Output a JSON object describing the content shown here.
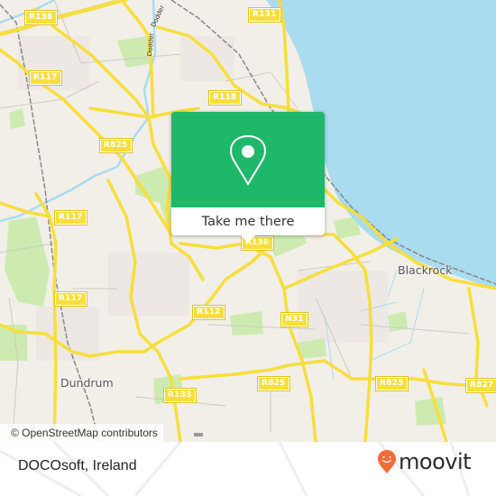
{
  "map": {
    "colors": {
      "land": "#f2efe9",
      "water": "#a9dcee",
      "park": "#cdebb0",
      "road_major": "#f7de3c",
      "railway": "#777777",
      "accent": "#1fb76a"
    },
    "road_shields": [
      {
        "id": "r138-nw",
        "label": "R138"
      },
      {
        "id": "r131",
        "label": "R131"
      },
      {
        "id": "r117-n",
        "label": "R117"
      },
      {
        "id": "r118",
        "label": "R118"
      },
      {
        "id": "r825-w",
        "label": "R825"
      },
      {
        "id": "r117-mid",
        "label": "R117"
      },
      {
        "id": "r138-center",
        "label": "R138"
      },
      {
        "id": "r117-s",
        "label": "R117"
      },
      {
        "id": "r112",
        "label": "R112"
      },
      {
        "id": "n31",
        "label": "N31"
      },
      {
        "id": "r133",
        "label": "R133"
      },
      {
        "id": "r825-s",
        "label": "R825"
      },
      {
        "id": "r825-e",
        "label": "R825"
      },
      {
        "id": "r827",
        "label": "R827"
      }
    ],
    "places": [
      {
        "id": "blackrock",
        "label": "Blackrock"
      },
      {
        "id": "dundrum",
        "label": "Dundrum"
      }
    ],
    "river_labels": [
      {
        "id": "dodder-1",
        "label": "Dodder"
      },
      {
        "id": "dodder-2",
        "label": "Dodder"
      }
    ],
    "attribution": "© OpenStreetMap contributors"
  },
  "popup": {
    "icon": "map-pin-icon",
    "button_label": "Take me there"
  },
  "footer": {
    "location_title": "DOCOsoft, Ireland",
    "brand": {
      "icon": "moovit-smiley-pin-icon",
      "name": "moovit",
      "color": "#f26b3a"
    }
  }
}
